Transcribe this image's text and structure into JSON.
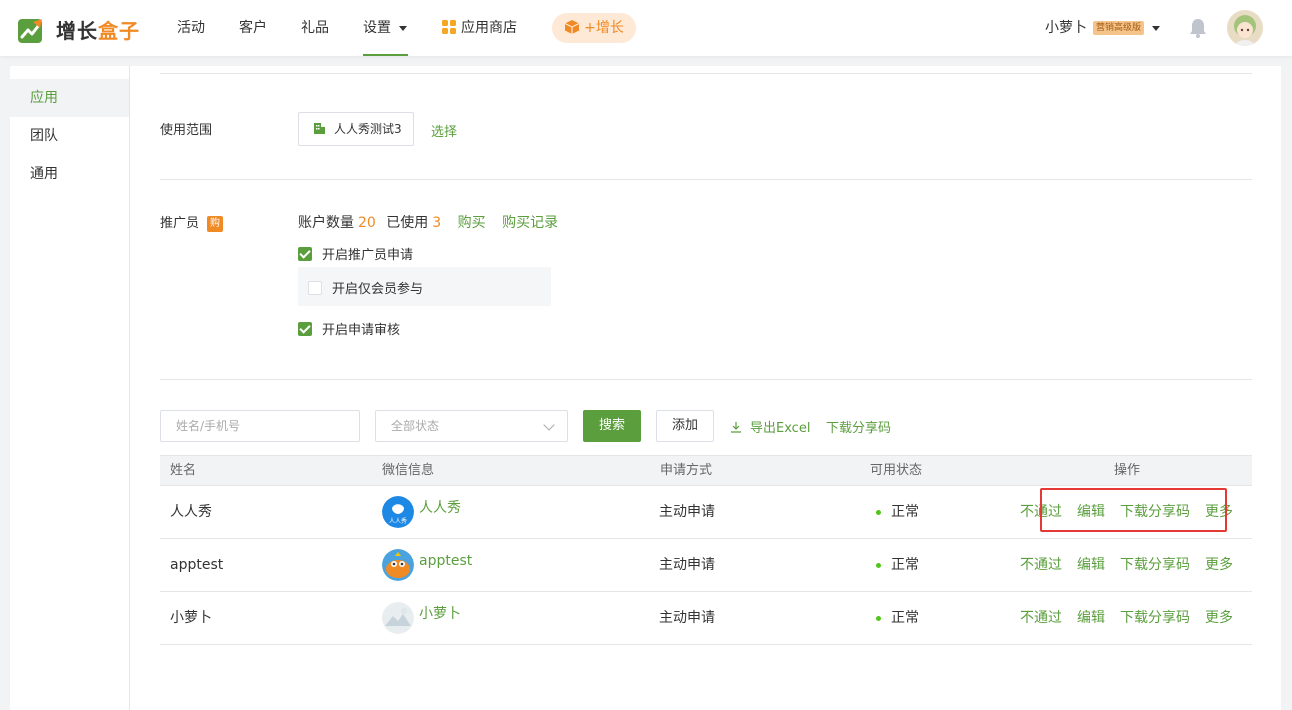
{
  "brand": {
    "name_main": "增长",
    "name_accent": "盒子"
  },
  "nav": {
    "items": [
      "活动",
      "客户",
      "礼品",
      "设置"
    ],
    "store": "应用商店",
    "grow": "+增长"
  },
  "user": {
    "name": "小萝卜",
    "badge": "营销高级版"
  },
  "sidebar": {
    "items": [
      "应用",
      "团队",
      "通用"
    ]
  },
  "scope": {
    "label": "使用范围",
    "value": "人人秀测试3",
    "select": "选择"
  },
  "promoter": {
    "label": "推广员",
    "badge": "购",
    "account_label": "账户数量",
    "account_count": "20",
    "used_label": "已使用",
    "used_count": "3",
    "buy": "购买",
    "buy_record": "购买记录",
    "options": [
      {
        "label": "开启推广员申请",
        "checked": true
      },
      {
        "label": "开启仅会员参与",
        "checked": false
      },
      {
        "label": "开启申请审核",
        "checked": true
      }
    ]
  },
  "filters": {
    "search_placeholder": "姓名/手机号",
    "status_placeholder": "全部状态",
    "search_btn": "搜索",
    "add_btn": "添加",
    "export": "导出Excel",
    "download": "下载分享码"
  },
  "table": {
    "headers": [
      "姓名",
      "微信信息",
      "申请方式",
      "可用状态",
      "操作"
    ],
    "rows": [
      {
        "name": "人人秀",
        "wechat": "人人秀",
        "method": "主动申请",
        "status": "正常"
      },
      {
        "name": "apptest",
        "wechat": "apptest",
        "method": "主动申请",
        "status": "正常"
      },
      {
        "name": "小萝卜",
        "wechat": "小萝卜",
        "method": "主动申请",
        "status": "正常"
      }
    ],
    "actions": [
      "不通过",
      "编辑",
      "下载分享码",
      "更多"
    ]
  },
  "colors": {
    "primary": "#5b9e3e",
    "accent": "#f08a24",
    "highlight": "#e53935"
  }
}
